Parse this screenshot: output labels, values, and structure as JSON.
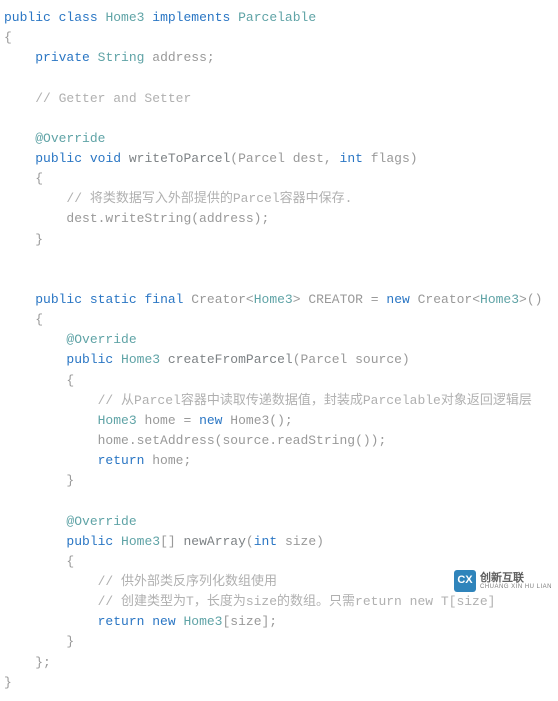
{
  "code": {
    "l1_public": "public",
    "l1_class": "class",
    "l1_name": "Home3",
    "l1_implements": "implements",
    "l1_iface": "Parcelable",
    "l2_brace": "{",
    "l3_private": "private",
    "l3_type": "String",
    "l3_field": "address;",
    "l4_comment": "// Getter and Setter",
    "l5_ann": "@Override",
    "l6_public": "public",
    "l6_void": "void",
    "l6_method": "writeToParcel",
    "l6_params": "(Parcel dest,",
    "l6_int": "int",
    "l6_flags": "flags)",
    "l7_brace": "{",
    "l8_comment": "// 将类数据写入外部提供的Parcel容器中保存.",
    "l9_stmt": "dest.writeString(address);",
    "l10_brace": "}",
    "l11_public": "public",
    "l11_static": "static",
    "l11_final": "final",
    "l11_creator1": "Creator<",
    "l11_home3a": "Home3",
    "l11_gt1": ">",
    "l11_var": "CREATOR =",
    "l11_new": "new",
    "l11_creator2": "Creator<",
    "l11_home3b": "Home3",
    "l11_gt2": ">()",
    "l12_brace": "{",
    "l13_ann": "@Override",
    "l14_public": "public",
    "l14_type": "Home3",
    "l14_method": "createFromParcel",
    "l14_params": "(Parcel source)",
    "l15_brace": "{",
    "l16_comment": "// 从Parcel容器中读取传递数据值，封装成Parcelable对象返回逻辑层",
    "l17_type": "Home3",
    "l17_home": "home =",
    "l17_new": "new",
    "l17_ctor": "Home3();",
    "l18_stmt": "home.setAddress(source.readString());",
    "l19_return": "return",
    "l19_home": "home;",
    "l20_brace": "}",
    "l21_ann": "@Override",
    "l22_public": "public",
    "l22_type": "Home3",
    "l22_arr": "[]",
    "l22_method": "newArray",
    "l22_lp": "(",
    "l22_int": "int",
    "l22_size": "size)",
    "l23_brace": "{",
    "l24_comment1": "// 供外部类反序列化数组使用",
    "l24_comment2": "// 创建类型为T，长度为size的数组。只需return new T[size]",
    "l25_return": "return",
    "l25_new": "new",
    "l25_type": "Home3",
    "l25_tail": "[size];",
    "l26_brace": "}",
    "l27_brace": "};",
    "l28_brace": "}"
  },
  "watermark": {
    "icon": "CX",
    "zh": "创新互联",
    "py": "CHUANG XIN HU LIAN"
  }
}
